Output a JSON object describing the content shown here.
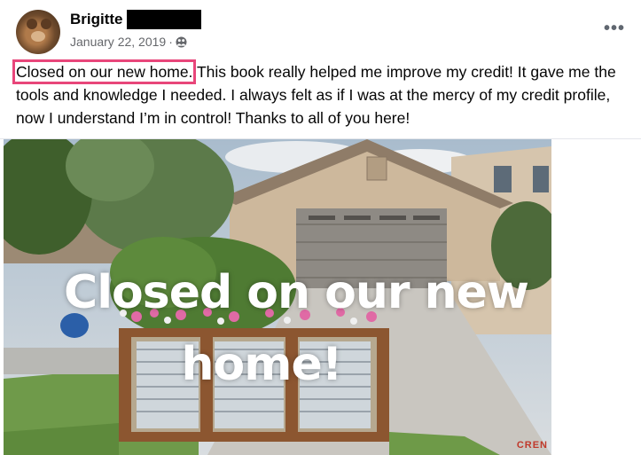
{
  "post": {
    "author_name": "Brigitte",
    "date": "January 22, 2019",
    "separator": "·",
    "privacy_icon": "friends-icon",
    "more_icon": "more-dots-icon",
    "more_glyph": "•••",
    "text_highlighted": "Closed on our new home.",
    "text_rest": " This book really helped me improve my credit! It gave me the tools and knowledge I needed. I always felt as if I was at the mercy of my credit profile, now I understand I’m in control! Thanks to all of you here!"
  },
  "image": {
    "overlay_line1": "Closed on our new",
    "overlay_line2": "home!",
    "watermark": "CREN"
  },
  "colors": {
    "highlight_box": "#e8467a",
    "secondary_text": "#65676b"
  }
}
